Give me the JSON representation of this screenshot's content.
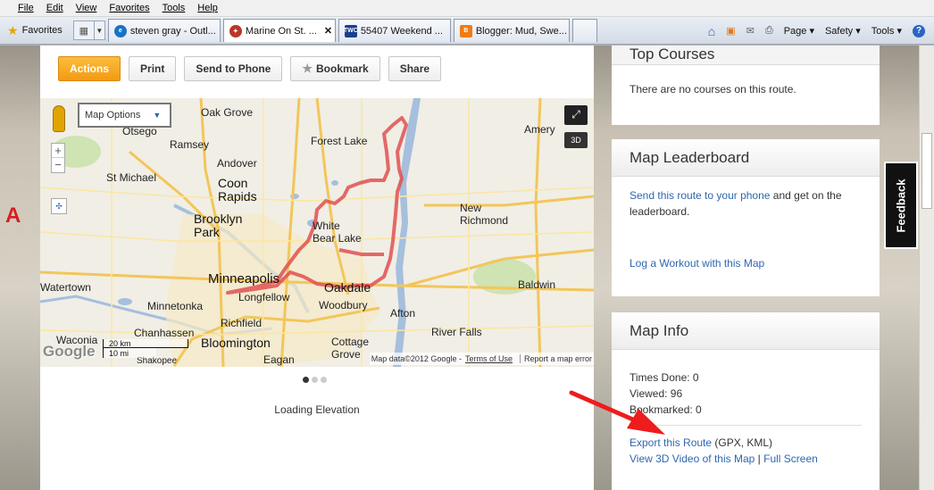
{
  "menu": [
    "File",
    "Edit",
    "View",
    "Favorites",
    "Tools",
    "Help"
  ],
  "favorites_label": "Favorites",
  "tabs": [
    {
      "label": "steven gray - Outl...",
      "icon_color": "#1a72c9"
    },
    {
      "label": "Marine On St. ...",
      "icon_color": "#b8372a",
      "active": true
    },
    {
      "label": "55407 Weekend ...",
      "icon_color": "#1a3f8f"
    },
    {
      "label": "Blogger: Mud, Swe...",
      "icon_color": "#f07b16"
    }
  ],
  "tab_icon_text": {
    "twc": "TWC"
  },
  "command_bar": {
    "page": "Page",
    "safety": "Safety",
    "tools": "Tools"
  },
  "actions": {
    "actions_label": "Actions",
    "print_label": "Print",
    "send_label": "Send to Phone",
    "bookmark_label": "Bookmark",
    "share_label": "Share"
  },
  "map": {
    "options_label": "Map Options",
    "btn_3d": "3D",
    "places": {
      "oak_grove": "Oak Grove",
      "otsego": "Otsego",
      "ramsey": "Ramsey",
      "forest_lake": "Forest Lake",
      "amery": "Amery",
      "andover": "Andover",
      "st_michael": "St Michael",
      "coon_rapids": "Coon\nRapids",
      "brooklyn_park": "Brooklyn\nPark",
      "white_bear_lake": "White\nBear Lake",
      "new_richmond": "New\nRichmond",
      "minneapolis": "Minneapolis",
      "oakdale": "Oakdale",
      "watertown": "Watertown",
      "minnetonka": "Minnetonka",
      "longfellow": "Longfellow",
      "woodbury": "Woodbury",
      "baldwin": "Baldwin",
      "richfield": "Richfield",
      "afton": "Afton",
      "chanhassen": "Chanhassen",
      "bloomington": "Bloomington",
      "river_falls": "River Falls",
      "waconia": "Waconia",
      "cottage_grove": "Cottage\nGrove",
      "eagan": "Eagan",
      "shakopee": "Shakopee"
    },
    "highways": [
      "10",
      "52",
      "35W",
      "35E",
      "94",
      "94",
      "694",
      "494",
      "12",
      "63",
      "63",
      "95",
      "52",
      "94",
      "35"
    ],
    "scale_km": "20 km",
    "scale_mi": "10 mi",
    "google": "Google",
    "attribution": "Map data©2012 Google -",
    "terms": "Terms of Use",
    "report": "Report a map error",
    "route_color": "#e05050"
  },
  "loading_text": "Loading Elevation",
  "top_courses": {
    "title": "Top Courses",
    "body": "There are no courses on this route."
  },
  "leaderboard": {
    "title": "Map Leaderboard",
    "send_link": "Send this route to your phone",
    "send_rest": " and get on the leaderboard.",
    "log_link": "Log a Workout with this Map"
  },
  "map_info": {
    "title": "Map Info",
    "times_done": "Times Done: 0",
    "viewed": "Viewed: 96",
    "bookmarked": "Bookmarked: 0",
    "export_link": "Export this Route",
    "export_rest": " (GPX, KML)",
    "video_link": "View 3D Video of this Map",
    "sep": " | ",
    "full_link": "Full Screen"
  },
  "feedback_label": "Feedback",
  "bg_letter": "A",
  "arrow_color": "#ee1c1c"
}
